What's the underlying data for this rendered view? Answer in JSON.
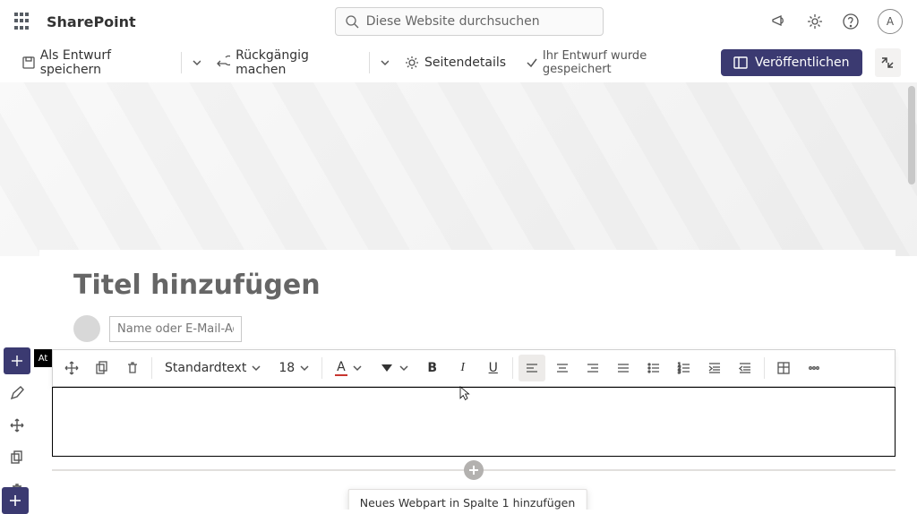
{
  "header": {
    "brand": "SharePoint",
    "search_placeholder": "Diese Website durchsuchen",
    "avatar_initial": "A"
  },
  "commandbar": {
    "save_draft": "Als Entwurf speichern",
    "undo": "Rückgängig machen",
    "page_details": "Seitendetails",
    "status": "Ihr Entwurf wurde gespeichert",
    "publish": "Veröffentlichen"
  },
  "page": {
    "title_placeholder": "Titel hinzufügen",
    "name_placeholder": "Name oder E-Mail-Adre",
    "webpart_tag": "At"
  },
  "toolbar": {
    "style_label": "Standardtext",
    "font_size": "18",
    "letter": "A"
  },
  "tooltip": "Neues Webpart in Spalte 1 hinzufügen"
}
